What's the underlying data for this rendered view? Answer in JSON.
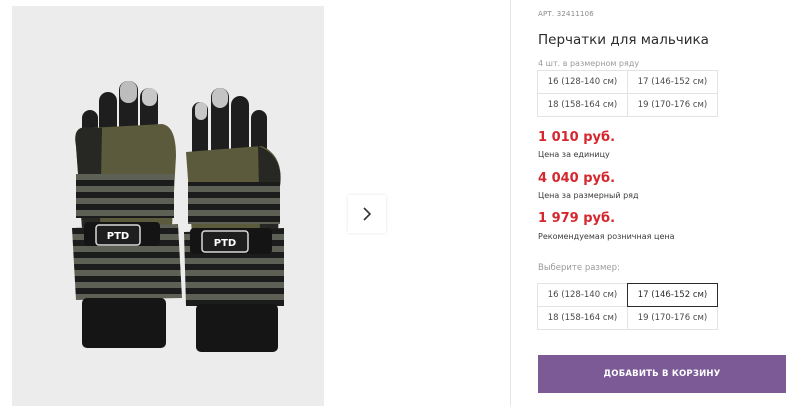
{
  "product": {
    "article": "АРТ. 32411106",
    "title": "Перчатки для мальчика",
    "set_note": "4 шт. в размерном ряду",
    "set_sizes": [
      "16 (128-140 см)",
      "17 (146-152 см)",
      "18 (158-164 см)",
      "19 (170-176 см)"
    ]
  },
  "prices": {
    "unit_price": "1 010 руб.",
    "unit_label": "Цена за единицу",
    "set_price": "4 040 руб.",
    "set_label": "Цена за размерный ряд",
    "retail_price": "1 979 руб.",
    "retail_label": "Рекомендуемая розничная цена"
  },
  "size_select": {
    "label": "Выберите размер:",
    "options": [
      "16 (128-140 см)",
      "17 (146-152 см)",
      "18 (158-164 см)",
      "19 (170-176 см)"
    ],
    "selected": "17 (146-152 см)"
  },
  "cart_button": {
    "label": "ДОБАВИТЬ В КОРЗИНУ"
  },
  "gallery": {
    "next_icon": "chevron-right-icon",
    "image_logo": "PTD"
  },
  "colors": {
    "price_red": "#d6262e",
    "button_purple": "#7b5a96",
    "gallery_bg": "#ececec",
    "glove_olive": "#5b5a3c"
  }
}
